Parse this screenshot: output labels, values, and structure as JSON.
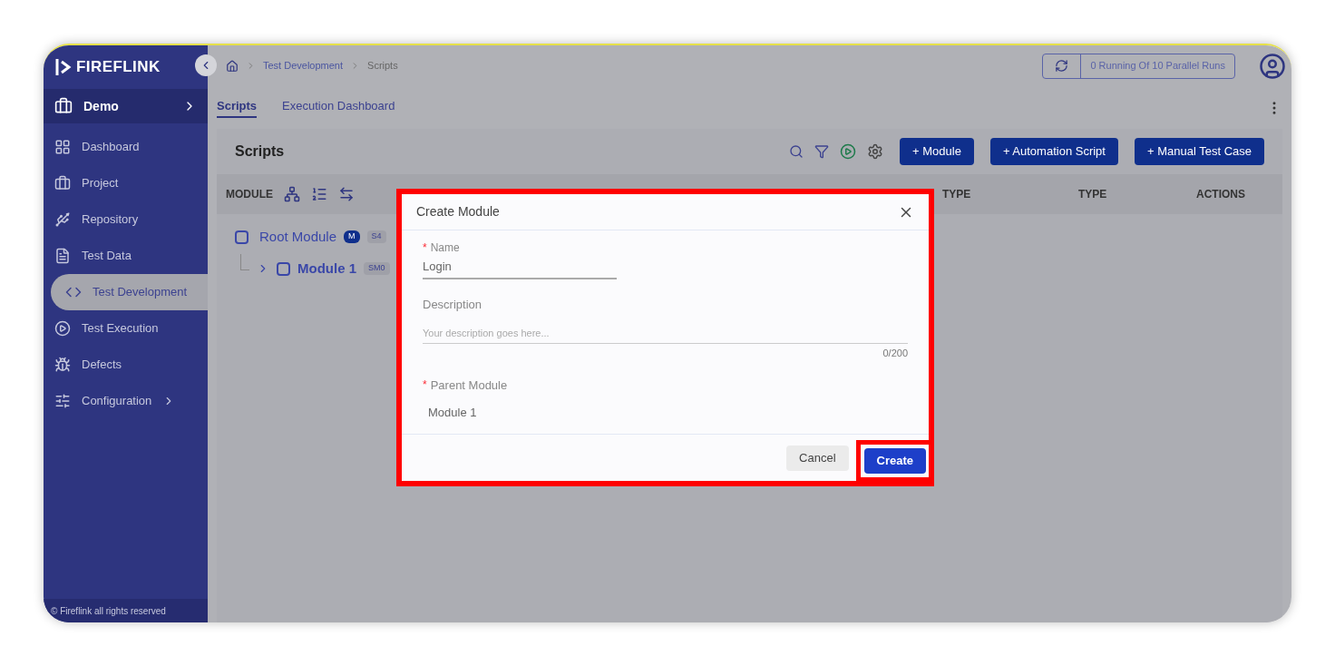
{
  "sidebar": {
    "logo": "FIREFLINK",
    "project": {
      "label": "Demo"
    },
    "items": [
      {
        "label": "Dashboard",
        "kind": "dashboard",
        "selected": false,
        "has_submenu": false
      },
      {
        "label": "Project",
        "kind": "project",
        "selected": false,
        "has_submenu": false
      },
      {
        "label": "Repository",
        "kind": "repository",
        "selected": false,
        "has_submenu": false
      },
      {
        "label": "Test Data",
        "kind": "data",
        "selected": false,
        "has_submenu": false
      },
      {
        "label": "Test Development",
        "kind": "code",
        "selected": true,
        "has_submenu": false
      },
      {
        "label": "Test Execution",
        "kind": "execution",
        "selected": false,
        "has_submenu": false
      },
      {
        "label": "Defects",
        "kind": "defects",
        "selected": false,
        "has_submenu": false
      },
      {
        "label": "Configuration",
        "kind": "config",
        "selected": false,
        "has_submenu": true
      }
    ],
    "footer": "© Fireflink all rights reserved"
  },
  "breadcrumb": [
    "Test Development",
    "Scripts"
  ],
  "parallel_runs": "0 Running Of 10 Parallel Runs",
  "tabs": [
    {
      "label": "Scripts",
      "selected": true
    },
    {
      "label": "Execution Dashboard",
      "selected": false
    }
  ],
  "page_title": "Scripts",
  "action_buttons": [
    "+ Module",
    "+ Automation Script",
    "+ Manual Test Case"
  ],
  "table": {
    "columns": [
      "MODULE",
      "TYPE",
      "TYPE",
      "ACTIONS"
    ],
    "rows": [
      {
        "name": "Root Module",
        "checked": false,
        "badges": [
          "M",
          "S4"
        ],
        "children": [
          {
            "name": "Module 1",
            "checked": false,
            "badges": [
              "SM0"
            ]
          }
        ]
      }
    ]
  },
  "dialog": {
    "title": "Create Module",
    "name_field": {
      "required_mark": "*",
      "label": "Name",
      "value": "Login"
    },
    "description_field": {
      "label": "Description",
      "placeholder": "Your description goes here...",
      "counter": "0/200"
    },
    "parent_field": {
      "required_mark": "*",
      "label": "Parent Module",
      "value": "Module 1"
    },
    "buttons": [
      {
        "label": "Cancel",
        "kind": "secondary",
        "highlighted": false
      },
      {
        "label": "Create",
        "kind": "primary",
        "highlighted": true
      }
    ]
  }
}
